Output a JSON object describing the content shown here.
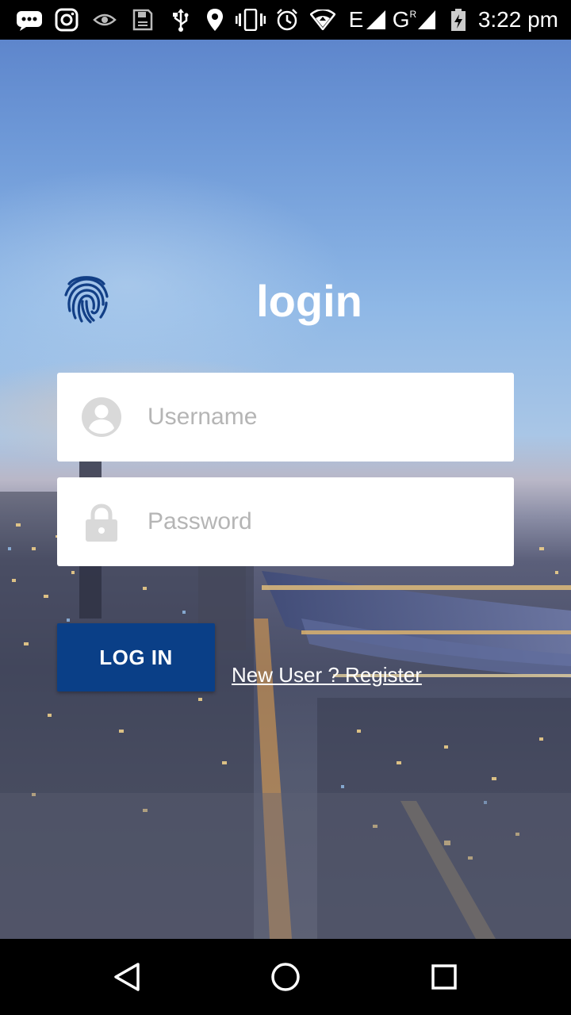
{
  "status_bar": {
    "time": "3:22 pm",
    "icons": [
      "messages-icon",
      "instagram-icon",
      "eye-icon",
      "save-icon",
      "usb-icon",
      "location-icon",
      "vibrate-icon",
      "alarm-icon",
      "wifi-icon",
      "signal-e-icon",
      "signal-g-icon",
      "battery-charging-icon"
    ],
    "network_labels": [
      "E",
      "G"
    ]
  },
  "login": {
    "title": "login",
    "username_placeholder": "Username",
    "password_placeholder": "Password",
    "login_button_label": "LOG IN",
    "register_link_label": "New User ? Register"
  },
  "colors": {
    "primary_button": "#0a3f87",
    "fingerprint": "#123f86",
    "field_icon": "#d9d9d9",
    "placeholder": "#b5b5b5"
  }
}
